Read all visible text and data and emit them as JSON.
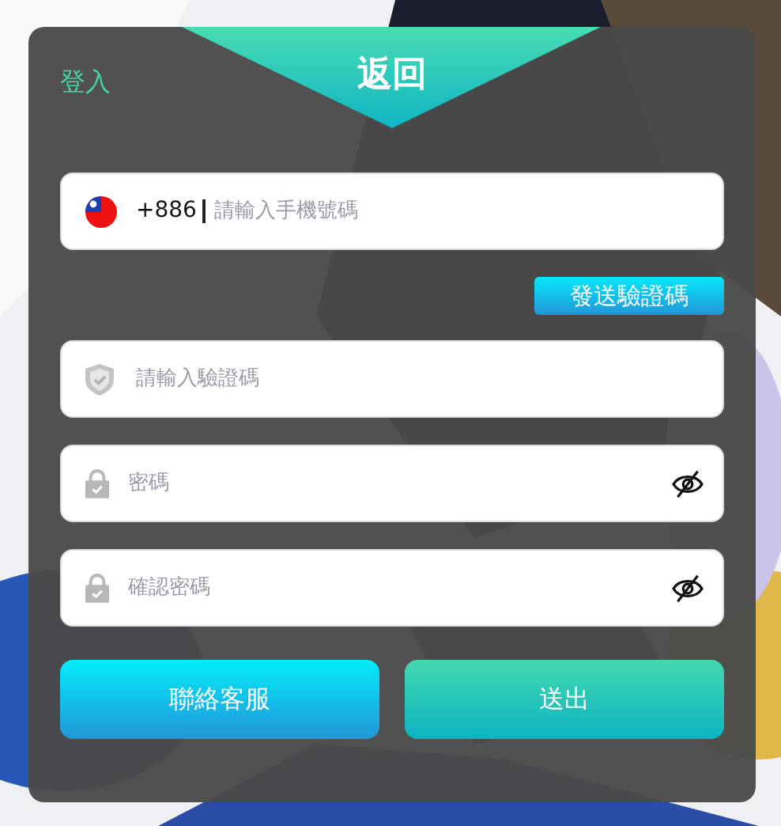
{
  "header": {
    "login_link": "登入",
    "title": "返回"
  },
  "phone": {
    "country_code": "+886",
    "placeholder": "請輸入手機號碼"
  },
  "send_code_button": "發送驗證碼",
  "fields": [
    {
      "kind": "code",
      "placeholder": "請輸入驗證碼",
      "toggle_visibility": false
    },
    {
      "kind": "password",
      "placeholder": "密碼",
      "toggle_visibility": true
    },
    {
      "kind": "password",
      "placeholder": "確認密碼",
      "toggle_visibility": true
    }
  ],
  "buttons": [
    {
      "kind": "support",
      "label": "聯絡客服"
    },
    {
      "kind": "submit",
      "label": "送出"
    }
  ]
}
